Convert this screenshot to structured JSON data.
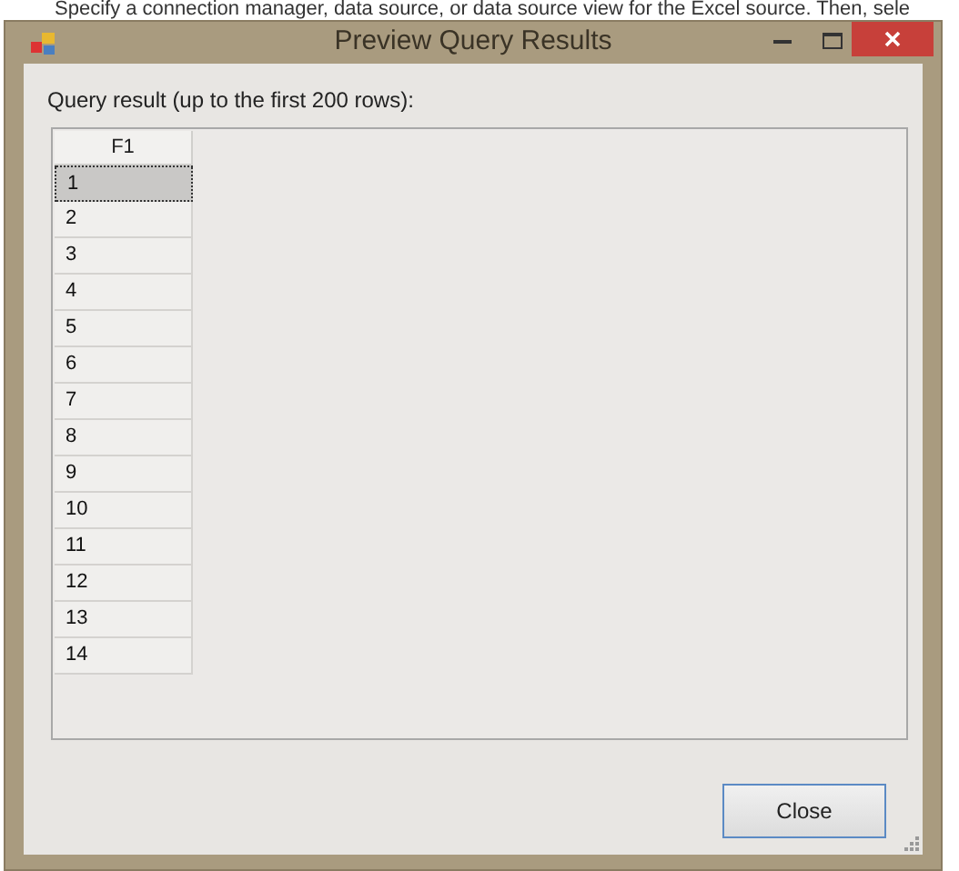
{
  "background_text": "Specify a connection manager, data source, or data source view for the Excel source. Then, sele",
  "window": {
    "title": "Preview Query Results"
  },
  "label": "Query result (up to the first 200 rows):",
  "table": {
    "columns": [
      "F1"
    ],
    "rows": [
      {
        "cells": [
          "1"
        ],
        "selected": true
      },
      {
        "cells": [
          "2"
        ],
        "selected": false
      },
      {
        "cells": [
          "3"
        ],
        "selected": false
      },
      {
        "cells": [
          "4"
        ],
        "selected": false
      },
      {
        "cells": [
          "5"
        ],
        "selected": false
      },
      {
        "cells": [
          "6"
        ],
        "selected": false
      },
      {
        "cells": [
          "7"
        ],
        "selected": false
      },
      {
        "cells": [
          "8"
        ],
        "selected": false
      },
      {
        "cells": [
          "9"
        ],
        "selected": false
      },
      {
        "cells": [
          "10"
        ],
        "selected": false
      },
      {
        "cells": [
          "11"
        ],
        "selected": false
      },
      {
        "cells": [
          "12"
        ],
        "selected": false
      },
      {
        "cells": [
          "13"
        ],
        "selected": false
      },
      {
        "cells": [
          "14"
        ],
        "selected": false
      }
    ]
  },
  "buttons": [
    "Close"
  ]
}
